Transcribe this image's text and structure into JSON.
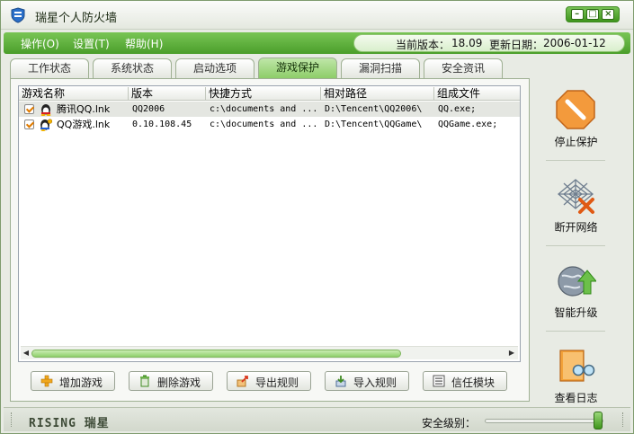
{
  "window": {
    "title": "瑞星个人防火墙",
    "buttons": {
      "minimize": "–",
      "maximize": "□",
      "close": "×"
    }
  },
  "menu": {
    "items": [
      {
        "label": "操作(O)"
      },
      {
        "label": "设置(T)"
      },
      {
        "label": "帮助(H)"
      }
    ],
    "version_label": "当前版本：",
    "version_value": "18.09",
    "update_label": "更新日期：",
    "update_value": "2006-01-12"
  },
  "tabs": [
    {
      "label": "工作状态",
      "active": false
    },
    {
      "label": "系统状态",
      "active": false
    },
    {
      "label": "启动选项",
      "active": false
    },
    {
      "label": "游戏保护",
      "active": true
    },
    {
      "label": "漏洞扫描",
      "active": false
    },
    {
      "label": "安全资讯",
      "active": false
    }
  ],
  "table": {
    "columns": [
      "游戏名称",
      "版本",
      "快捷方式",
      "相对路径",
      "组成文件"
    ],
    "rows": [
      {
        "checked": true,
        "name": "腾讯QQ.lnk",
        "version": "QQ2006",
        "shortcut": "c:\\documents and ...",
        "path": "D:\\Tencent\\QQ2006\\",
        "files": "QQ.exe;"
      },
      {
        "checked": true,
        "name": "QQ游戏.lnk",
        "version": "0.10.108.45",
        "shortcut": "c:\\documents and ...",
        "path": "D:\\Tencent\\QQGame\\",
        "files": "QQGame.exe;"
      }
    ]
  },
  "scroll": {
    "position": 0.0,
    "visible_fraction": 0.78
  },
  "buttons": [
    {
      "label": "增加游戏",
      "icon": "plus-icon"
    },
    {
      "label": "删除游戏",
      "icon": "trash-icon"
    },
    {
      "label": "导出规则",
      "icon": "export-icon"
    },
    {
      "label": "导入规则",
      "icon": "import-icon"
    },
    {
      "label": "信任模块",
      "icon": "list-icon"
    }
  ],
  "side": [
    {
      "label": "停止保护",
      "icon": "stop-icon"
    },
    {
      "label": "断开网络",
      "icon": "disconnect-icon"
    },
    {
      "label": "智能升级",
      "icon": "upgrade-icon"
    },
    {
      "label": "查看日志",
      "icon": "log-icon"
    }
  ],
  "status": {
    "logo_text": "RISING 瑞星",
    "security_label": "安全级别：",
    "security_level": 1.0
  },
  "colors": {
    "accent_green": "#4a9e2a",
    "tab_active": "#8bcc66",
    "checkbox_mark": "#e07b00"
  }
}
